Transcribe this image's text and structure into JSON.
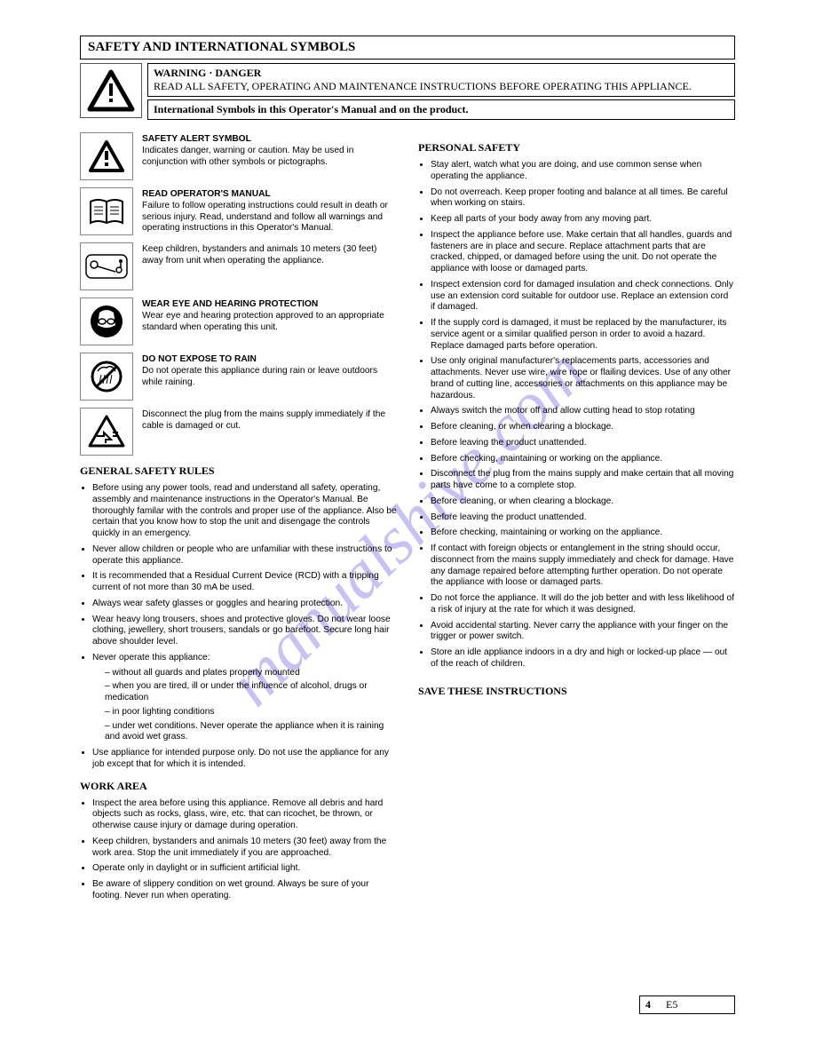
{
  "title": "SAFETY AND INTERNATIONAL SYMBOLS",
  "warning": {
    "label": "WARNING · DANGER",
    "text": "READ ALL SAFETY, OPERATING AND MAINTENANCE INSTRUCTIONS BEFORE OPERATING THIS APPLIANCE."
  },
  "header_sub": "International Symbols in this Operator's Manual and on the product.",
  "symbols": [
    {
      "key": "sym_attention",
      "label": "SAFETY ALERT SYMBOL",
      "text": "Indicates danger, warning or caution. May be used in conjunction with other symbols or pictographs."
    },
    {
      "key": "sym_manual",
      "label": "READ OPERATOR'S MANUAL",
      "text": "Failure to follow operating instructions could result in death or serious injury. Read, understand and follow all warnings and operating instructions in this Operator's Manual."
    },
    {
      "key": "sym_bystander",
      "label": "",
      "text": "Keep children, bystanders and animals 10 meters (30 feet) away from unit when operating the appliance."
    },
    {
      "key": "sym_goggles",
      "label": "WEAR EYE AND HEARING PROTECTION",
      "text": "Wear eye and hearing protection approved to an appropriate standard when operating this unit."
    },
    {
      "key": "sym_rain",
      "label": "DO NOT EXPOSE TO RAIN",
      "text": "Do not operate this appliance during rain or leave outdoors while raining."
    },
    {
      "key": "sym_plug",
      "label": "",
      "text": "Disconnect the plug from the mains supply immediately if the cable is damaged or cut."
    }
  ],
  "general_rules_heading": "GENERAL SAFETY RULES",
  "general_rules_items": [
    "Before using any power tools, read and understand all safety, operating, assembly and maintenance instructions in the Operator's Manual. Be thoroughly familar with the controls and proper use of the appliance. Also be certain that you know how to stop the unit and disengage the controls quickly in an emergency.",
    "Never allow children or people who are unfamiliar with these instructions to operate this appliance.",
    "It is recommended that a Residual Current Device (RCD) with a tripping current of not more than 30 mA be used.",
    "Always wear safety glasses or goggles and hearing protection.",
    "Wear heavy long trousers, shoes and protective gloves. Do not wear loose clothing, jewellery, short trousers, sandals or go barefoot. Secure long hair above shoulder level.",
    {
      "lead": "Never operate this appliance:",
      "sub": [
        "without all guards and plates properly mounted",
        "when you are tired, ill or under the influence of alcohol, drugs or medication",
        "in poor lighting conditions",
        "under wet conditions. Never operate the appliance when it is raining and avoid wet grass."
      ]
    },
    "Use appliance for intended purpose only. Do not use the appliance for any job except that for which it is intended."
  ],
  "work_area_heading": "WORK AREA",
  "work_area_items": [
    "Inspect the area before using this appliance. Remove all debris and hard objects such as rocks, glass, wire, etc. that can ricochet, be thrown, or otherwise cause injury or damage during operation.",
    "Keep children, bystanders and animals 10 meters (30 feet) away from the work area. Stop the unit immediately if you are approached.",
    "Operate only in daylight or in sufficient artificial light.",
    "Be aware of slippery condition on wet ground. Always be sure of your footing. Never run when operating."
  ],
  "personal_heading": "PERSONAL SAFETY",
  "personal_items": [
    "Stay alert, watch what you are doing, and use common sense when operating the appliance.",
    "Do not overreach. Keep proper footing and balance at all times. Be careful when working on stairs.",
    "Keep all parts of your body away from any moving part.",
    "Inspect the appliance before use. Make certain that all handles, guards and fasteners are in place and secure. Replace attachment parts that are cracked, chipped, or damaged before using the unit. Do not operate the appliance with loose or damaged parts.",
    "Inspect extension cord for damaged insulation and check connections. Only use an extension cord suitable for outdoor use. Replace an extension cord if damaged.",
    "If the supply cord is damaged, it must be replaced by the manufacturer, its service agent or a similar qualified person in order to avoid a hazard. Replace damaged parts before operation.",
    "Use only original manufacturer's replacements parts, accessories and attachments. Never use wire, wire rope or flailing devices. Use of any other brand of cutting line, accessories or attachments on this appliance may be hazardous.",
    "Always switch the motor off and allow cutting head to stop rotating",
    "Before cleaning, or when clearing a blockage.",
    "Before leaving the product unattended.",
    "Before checking, maintaining or working on the appliance.",
    "Disconnect the plug from the mains supply and make certain that all moving parts have come to a complete stop.",
    "Before cleaning, or when clearing a blockage.",
    "Before leaving the product unattended.",
    "Before checking, maintaining or working on the appliance.",
    "If contact with foreign objects or entanglement in the string should occur, disconnect from the mains supply immediately and check for damage. Have any damage repaired before attempting further operation. Do not operate the appliance with loose or damaged parts.",
    "Do not force the appliance. It will do the job better and with less likelihood of a risk of injury at the rate for which it was designed.",
    "Avoid accidental starting. Never carry the appliance with your finger on the trigger or power switch.",
    "Store an idle appliance indoors in a dry and high or locked-up place — out of the reach of children."
  ],
  "save_note": "SAVE THESE INSTRUCTIONS",
  "page_section": "4",
  "page_number": "E5"
}
